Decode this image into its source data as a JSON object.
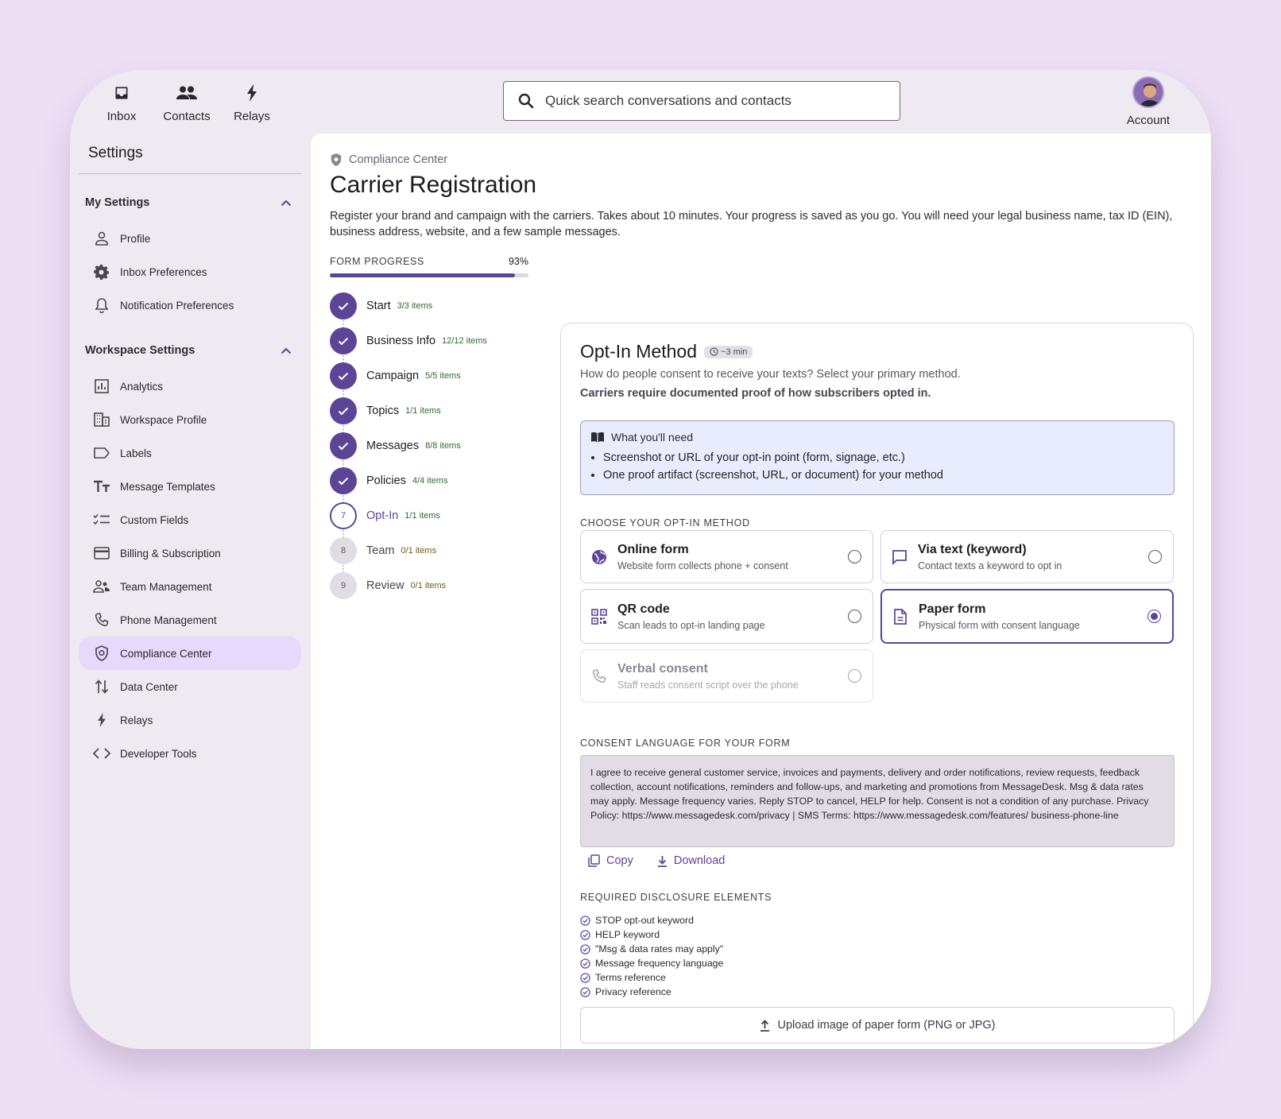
{
  "nav": {
    "items": [
      {
        "label": "Inbox",
        "icon": "inbox-icon"
      },
      {
        "label": "Contacts",
        "icon": "people-icon"
      },
      {
        "label": "Relays",
        "icon": "bolt-icon"
      }
    ],
    "account_label": "Account"
  },
  "search": {
    "placeholder": "Quick search conversations and contacts"
  },
  "sidebar": {
    "title": "Settings",
    "my_settings": {
      "label": "My Settings",
      "items": [
        {
          "label": "Profile"
        },
        {
          "label": "Inbox Preferences"
        },
        {
          "label": "Notification Preferences"
        }
      ]
    },
    "workspace_settings": {
      "label": "Workspace Settings",
      "items": [
        {
          "label": "Analytics"
        },
        {
          "label": "Workspace Profile"
        },
        {
          "label": "Labels"
        },
        {
          "label": "Message Templates"
        },
        {
          "label": "Custom Fields"
        },
        {
          "label": "Billing & Subscription"
        },
        {
          "label": "Team Management"
        },
        {
          "label": "Phone Management"
        },
        {
          "label": "Compliance Center"
        },
        {
          "label": "Data Center"
        },
        {
          "label": "Relays"
        },
        {
          "label": "Developer Tools"
        }
      ],
      "active": "Compliance Center"
    }
  },
  "main": {
    "breadcrumb": "Compliance Center",
    "title": "Carrier Registration",
    "description": "Register your brand and campaign with the carriers. Takes about 10 minutes. Your progress is saved as you go. You will need your legal business name, tax ID (EIN), business address, website, and a few sample messages."
  },
  "progress": {
    "label": "FORM PROGRESS",
    "percent_label": "93%",
    "percent": 93,
    "steps": [
      {
        "num": "1",
        "name": "Start",
        "count": "3/3 items",
        "state": "done"
      },
      {
        "num": "2",
        "name": "Business Info",
        "count": "12/12 items",
        "state": "done"
      },
      {
        "num": "3",
        "name": "Campaign",
        "count": "5/5 items",
        "state": "done"
      },
      {
        "num": "4",
        "name": "Topics",
        "count": "1/1 items",
        "state": "done"
      },
      {
        "num": "5",
        "name": "Messages",
        "count": "8/8 items",
        "state": "done"
      },
      {
        "num": "6",
        "name": "Policies",
        "count": "4/4 items",
        "state": "done"
      },
      {
        "num": "7",
        "name": "Opt-In",
        "count": "1/1 items",
        "state": "current"
      },
      {
        "num": "8",
        "name": "Team",
        "count": "0/1 items",
        "state": "todo"
      },
      {
        "num": "9",
        "name": "Review",
        "count": "0/1 items",
        "state": "todo"
      }
    ]
  },
  "optin": {
    "title": "Opt-In Method",
    "time_badge": "~3 min",
    "question": "How do people consent to receive your texts? Select your primary method.",
    "note": "Carriers require documented proof of how subscribers opted in.",
    "need": {
      "title": "What you'll need",
      "items": [
        "Screenshot or URL of your opt-in point (form, signage, etc.)",
        "One proof artifact (screenshot, URL, or document) for your method"
      ]
    },
    "choose_label": "CHOOSE YOUR OPT-IN METHOD",
    "methods": [
      {
        "name": "Online form",
        "desc": "Website form collects phone + consent",
        "icon": "globe-icon",
        "state": "default"
      },
      {
        "name": "Via text (keyword)",
        "desc": "Contact texts a keyword to opt in",
        "icon": "chat-icon",
        "state": "default"
      },
      {
        "name": "QR code",
        "desc": "Scan leads to opt-in landing page",
        "icon": "qr-icon",
        "state": "default"
      },
      {
        "name": "Paper form",
        "desc": "Physical form with consent language",
        "icon": "document-icon",
        "state": "selected"
      },
      {
        "name": "Verbal consent",
        "desc": "Staff reads consent script over the phone",
        "icon": "phone-icon",
        "state": "disabled"
      }
    ],
    "consent_label": "CONSENT LANGUAGE FOR YOUR FORM",
    "consent_text": "I agree to receive general customer service, invoices and payments, delivery and order notifications, review requests, feedback collection, account notifications, reminders and follow-ups, and marketing and promotions from MessageDesk. Msg & data rates may apply. Message frequency varies. Reply STOP to cancel, HELP for help. Consent is not a condition of any purchase. Privacy Policy: https://www.messagedesk.com/privacy | SMS Terms: https://www.messagedesk.com/features/ business-phone-line",
    "copy_label": "Copy",
    "download_label": "Download",
    "required_label": "REQUIRED DISCLOSURE ELEMENTS",
    "required_items": [
      "STOP opt-out keyword",
      "HELP keyword",
      "\"Msg & data rates may apply\"",
      "Message frequency language",
      "Terms reference",
      "Privacy reference"
    ],
    "upload_label": "Upload image of paper form (PNG or JPG)"
  },
  "colors": {
    "accent": "#5c4597",
    "active_bg": "#e7d9fb",
    "success": "#2e6d2f"
  }
}
